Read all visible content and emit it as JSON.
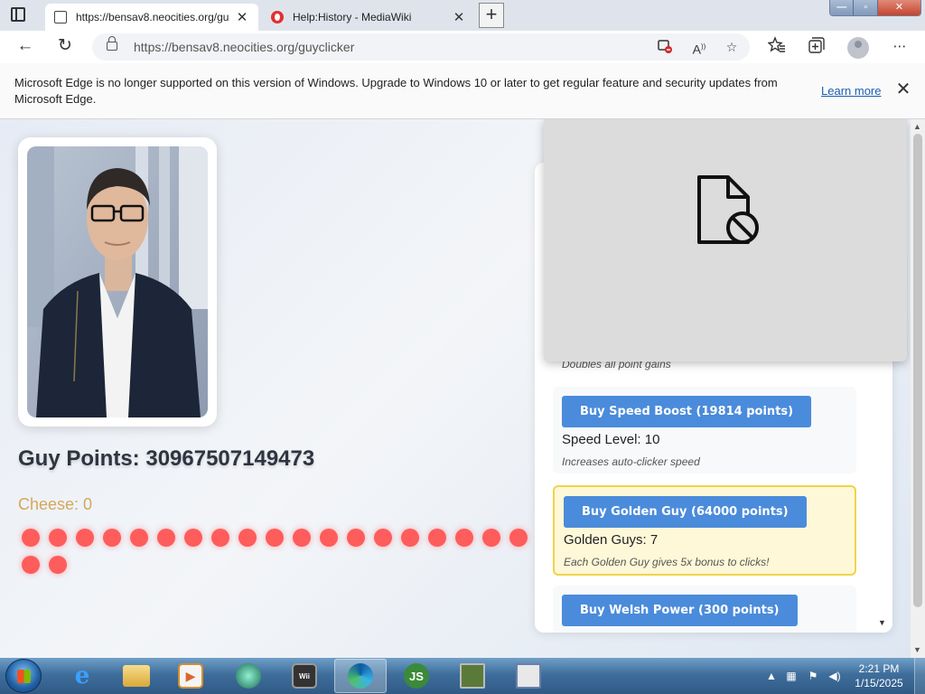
{
  "browser": {
    "tabs": [
      {
        "title": "https://bensav8.neocities.org/gu",
        "active": true
      },
      {
        "title": "Help:History - MediaWiki",
        "active": false
      }
    ],
    "tab_close_glyph": "✕",
    "new_tab_glyph": "+",
    "url": "https://bensav8.neocities.org/guyclicker",
    "icons": [
      "tab-actions-icon",
      "back-icon",
      "refresh-icon",
      "lock-icon",
      "tracking-blocked-icon",
      "read-aloud-icon",
      "add-favorite-icon",
      "favorites-icon",
      "collections-icon",
      "profile-icon",
      "more-icon"
    ],
    "back_glyph": "←",
    "refresh_glyph": "↻",
    "more_glyph": "⋯"
  },
  "notification": {
    "message": "Microsoft Edge is no longer supported on this version of Windows. Upgrade to Windows 10 or later to get regular feature and security updates from Microsoft Edge.",
    "link": "Learn more",
    "close_glyph": "✕"
  },
  "game": {
    "points_label": "Guy Points: 30967507149473",
    "cheese_label": "Cheese: 0",
    "dot_count": 21,
    "colors": {
      "dot": "#ff5c5c",
      "button": "#4a8bdb",
      "gold_border": "#f0d34a",
      "cheese": "#d4a85a"
    }
  },
  "store": {
    "partial_desc": "Doubles all point gains",
    "upgrades": [
      {
        "button": "Buy Speed Boost (19814 points)",
        "level": "Speed Level: 10",
        "desc": "Increases auto-clicker speed",
        "highlight": false
      },
      {
        "button": "Buy Golden Guy (64000 points)",
        "level": "Golden Guys: 7",
        "desc": "Each Golden Guy gives 5x bonus to clicks!",
        "highlight": true
      },
      {
        "button": "Buy Welsh Power (300 points)",
        "level": "",
        "desc": "",
        "highlight": false
      }
    ],
    "blocked_icon": "blocked-file-icon"
  },
  "taskbar": {
    "apps": [
      "internet-explorer-icon",
      "file-explorer-icon",
      "media-player-icon",
      "app-icon",
      "wii-icon",
      "edge-icon",
      "js-icon",
      "monitor-icon",
      "remote-desktop-icon"
    ],
    "active_app": "edge-icon",
    "clock_time": "2:21 PM",
    "clock_date": "1/15/2025"
  }
}
